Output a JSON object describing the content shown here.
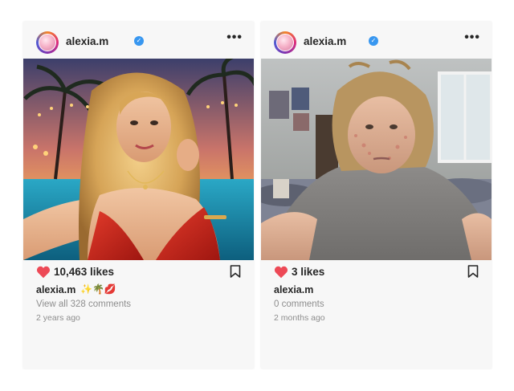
{
  "posts": [
    {
      "username": "alexia.m",
      "verified_icon": "✓",
      "more_icon": "•••",
      "likes": "10,463 likes",
      "caption_user": "alexia.m",
      "caption_emoji": "✨🌴💋",
      "comments": "View all 328 comments",
      "time": "2 years ago",
      "photo_alt": "glamorous sunset selfie"
    },
    {
      "username": "alexia.m",
      "verified_icon": "✓",
      "more_icon": "•••",
      "likes": "3 likes",
      "caption_user": "alexia.m",
      "caption_emoji": "",
      "comments": "0 comments",
      "time": "2 months ago",
      "photo_alt": "messy bedroom selfie"
    }
  ],
  "colors": {
    "heart": "#ed4956",
    "verified": "#3897f0",
    "text": "#262626",
    "muted": "#8e8e8e"
  },
  "icons": [
    "avatar",
    "verified-badge-icon",
    "more-options-icon",
    "heart-icon",
    "bookmark-icon"
  ]
}
